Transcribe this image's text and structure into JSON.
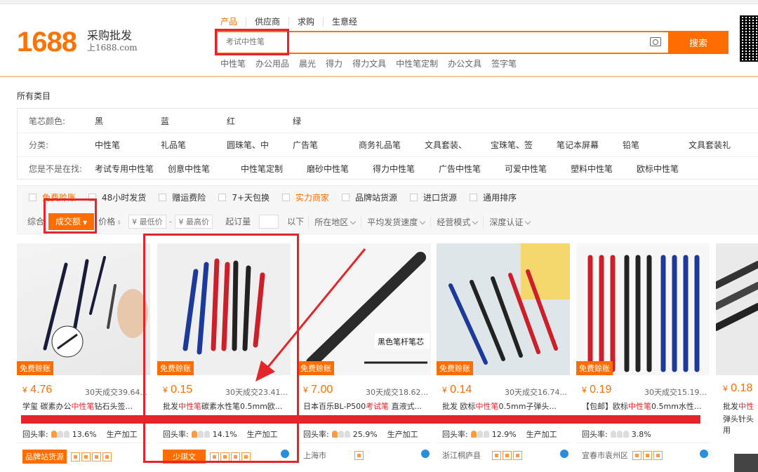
{
  "logo": {
    "number": "1688",
    "slogan": "采购批发",
    "url": "上1688.com"
  },
  "search": {
    "tabs": [
      "产品",
      "供应商",
      "求购",
      "生意经"
    ],
    "placeholder": "考试中性笔",
    "button": "搜索",
    "hot_words": [
      "中性笔",
      "办公用品",
      "晨光",
      "得力",
      "得力文具",
      "中性笔定制",
      "办公文具",
      "签字笔"
    ]
  },
  "filters": {
    "all_categories": "所有类目",
    "refill_color": {
      "label": "笔芯颜色:",
      "items": [
        "黑",
        "蓝",
        "红",
        "绿"
      ]
    },
    "category": {
      "label": "分类:",
      "items": [
        "中性笔",
        "礼品笔",
        "圆珠笔、中",
        "广告笔",
        "商务礼品笔",
        "文具套装、",
        "宝珠笔、签",
        "笔记本屏幕",
        "铅笔",
        "文具套装礼"
      ]
    },
    "suggest": {
      "label": "您是不是在找:",
      "items": [
        "考试专用中性笔",
        "创意中性笔",
        "中性笔定制",
        "磨砂中性笔",
        "得力中性笔",
        "广告中性笔",
        "可爱中性笔",
        "塑料中性笔",
        "欧标中性笔"
      ]
    }
  },
  "checkboxes": [
    "免费赊账",
    "48小时发货",
    "赠运费险",
    "7+天包换",
    "实力商家",
    "品牌站货源",
    "进口货源",
    "通用排序"
  ],
  "sort": {
    "comprehensive": "综合",
    "active": "成交额",
    "price": "价格",
    "min_price": "¥ 最低价",
    "dash": "-",
    "max_price": "¥ 最高价",
    "moq": "起订量",
    "below": "以下",
    "dropdowns": [
      "所在地区",
      "平均发货速度",
      "经营模式",
      "深度认证"
    ]
  },
  "products": [
    {
      "free": "免费赊账",
      "currency": "¥",
      "price": "4.76",
      "sales": "30天成交39.64...",
      "title_pre": "学玺 碳素办公",
      "title_hl": "中性笔",
      "title_post": "钻石头签...",
      "rate_label": "回头率:",
      "rate": "13.6%",
      "mode": "生产加工",
      "tag": "品牌站货源",
      "location": ""
    },
    {
      "free": "免费赊账",
      "currency": "¥",
      "price": "0.15",
      "sales": "30天成交23.41...",
      "title_pre": "批发",
      "title_hl": "中性笔",
      "title_post": "碳素水性笔0.5mm欧...",
      "rate_label": "回头率:",
      "rate": "14.1%",
      "mode": "生产加工",
      "tag": "少琪文",
      "location": ""
    },
    {
      "free": "免费赊账",
      "currency": "¥",
      "price": "7.00",
      "sales": "30天成交18.62...",
      "title_pre": "日本百乐BL-P500",
      "title_hl": "考试笔",
      "title_post": " 直液式...",
      "rate_label": "回头率:",
      "rate": "25.9%",
      "mode": "生产加工",
      "tag": "",
      "location": "上海市",
      "img_caption": "黑色笔杆笔芯"
    },
    {
      "free": "免费赊账",
      "currency": "¥",
      "price": "0.14",
      "sales": "30天成交16.74...",
      "title_pre": "批发 欧标",
      "title_hl": "中性笔",
      "title_post": "0.5mm子弹头...",
      "rate_label": "回头率:",
      "rate": "12.9%",
      "mode": "生产加工",
      "tag": "",
      "location": "浙江桐庐县"
    },
    {
      "free": "免费赊账",
      "currency": "¥",
      "price": "0.19",
      "sales": "30天成交15.19...",
      "title_pre": "【包邮】欧标",
      "title_hl": "中性笔",
      "title_post": "0.5mm水性...",
      "rate_label": "回头率:",
      "rate": "3.8%",
      "mode": "生产加工",
      "tag": "",
      "location": "宜春市袁州区"
    },
    {
      "free": "",
      "currency": "¥",
      "price": "0.18",
      "sales": "",
      "title_pre": "批发",
      "title_hl": "中性",
      "title_post": "",
      "line2": "弹头针头",
      "line3": "用",
      "rate_label": "",
      "rate": "",
      "mode": "",
      "tag": "",
      "location": ""
    }
  ],
  "colors": {
    "accent": "#ff6d00",
    "highlight_box": "#e4262b"
  }
}
